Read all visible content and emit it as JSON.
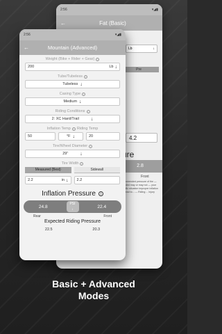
{
  "back_screen": {
    "status_time": "2:56",
    "title": "Fat (Basic)",
    "unit": "Lb",
    "tab_label": "Pre",
    "value": "4.2",
    "pressure_title_partial": "ure",
    "pressure_value": "2.8",
    "front_label": "Front",
    "note": "recommended pressure of the — provided may or may not — your specific situation improper inflation can lead to... — Riding ... injury"
  },
  "front_screen": {
    "status_time": "2:56",
    "title": "Mountain (Advanced)",
    "weight_label": "Weight (Bike + Rider + Gear)",
    "weight_value": "200",
    "weight_unit": "Lb",
    "tube_label": "Tube/Tubeless",
    "tube_value": "Tubeless",
    "casing_label": "Casing Type",
    "casing_value": "Medium",
    "conditions_label": "Riding Conditions",
    "conditions_value": "2: XC Hard/Trail",
    "inflation_temp_label": "Inflation Temp",
    "riding_temp_label": "Riding Temp",
    "inflation_temp_value": "50",
    "temp_unit": "°F",
    "riding_temp_value": "20",
    "diameter_label": "Tire/Wheel Diameter",
    "diameter_value": "29\"",
    "width_label": "Tire Width",
    "tab_measured": "Measured (Best)",
    "tab_sidewall": "Sidewall",
    "width_measured_value": "2.2",
    "width_unit": "in",
    "width_sidewall_value": "2.2",
    "pressure_title": "Inflation Pressure",
    "rear_pressure": "24.8",
    "front_pressure": "22.4",
    "pressure_unit": "PSI",
    "rear_label": "Rear",
    "front_label": "Front",
    "expected_title": "Expected Riding Pressure",
    "expected_rear": "22.5",
    "expected_front": "20.3"
  },
  "caption": {
    "line1": "Basic + Advanced",
    "line2": "Modes"
  }
}
